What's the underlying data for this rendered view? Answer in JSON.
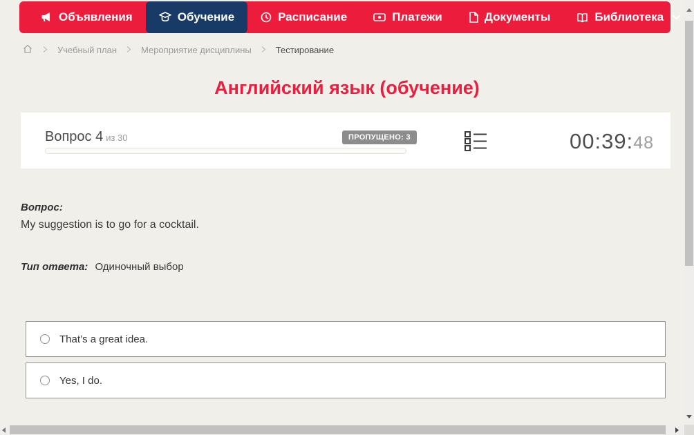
{
  "nav": {
    "items": [
      {
        "label": "Объявления",
        "icon": "megaphone-icon",
        "active": false
      },
      {
        "label": "Обучение",
        "icon": "graduation-cap-icon",
        "active": true
      },
      {
        "label": "Расписание",
        "icon": "clock-icon",
        "active": false
      },
      {
        "label": "Платежи",
        "icon": "banknote-icon",
        "active": false
      },
      {
        "label": "Документы",
        "icon": "document-icon",
        "active": false
      },
      {
        "label": "Библиотека",
        "icon": "open-book-icon",
        "active": false,
        "has_dropdown": true
      }
    ]
  },
  "breadcrumb": {
    "items": [
      "Учебный план",
      "Мероприятие дисциплины",
      "Тестирование"
    ]
  },
  "page": {
    "title": "Английский язык (обучение)"
  },
  "question_header": {
    "question_label": "Вопрос 4",
    "question_total": "из 30",
    "skipped_badge": "ПРОПУЩЕНО: 3",
    "progress_percent": 0,
    "timer_main": "00:39:",
    "timer_seconds": "48"
  },
  "question": {
    "label": "Вопрос:",
    "text": "My suggestion is to go for a cocktail.",
    "answer_type_label": "Тип ответа:",
    "answer_type_value": "Одиночный выбор",
    "options": [
      {
        "text": "That’s a great idea.",
        "selected": false
      },
      {
        "text": "Yes, I do.",
        "selected": false
      }
    ]
  },
  "colors": {
    "accent_red": "#ec1c3d",
    "active_navy": "#173a66",
    "badge_gray": "#8c8c8c",
    "page_background": "#f1efea"
  }
}
